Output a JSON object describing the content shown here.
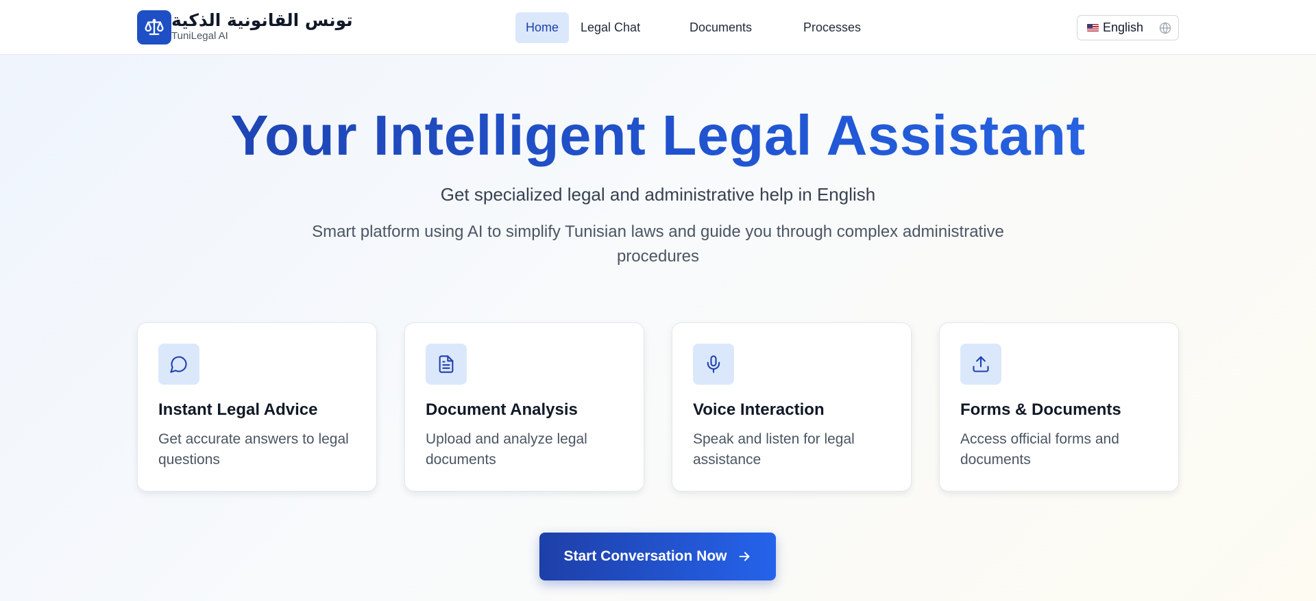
{
  "header": {
    "brand_ar": "تونس القانونية الذكية",
    "brand_en": "TuniLegal AI",
    "nav": [
      {
        "label": "Home",
        "active": true
      },
      {
        "label": "Legal Chat",
        "active": false
      },
      {
        "label": "Documents",
        "active": false
      },
      {
        "label": "Processes",
        "active": false
      }
    ],
    "language": "English"
  },
  "hero": {
    "title": "Your Intelligent Legal Assistant",
    "subtitle": "Get specialized legal and administrative help in English",
    "description": "Smart platform using AI to simplify Tunisian laws and guide you through complex administrative procedures"
  },
  "features": [
    {
      "icon": "chat-bubble-icon",
      "title": "Instant Legal Advice",
      "text": "Get accurate answers to legal questions"
    },
    {
      "icon": "document-icon",
      "title": "Document Analysis",
      "text": "Upload and analyze legal documents"
    },
    {
      "icon": "microphone-icon",
      "title": "Voice Interaction",
      "text": "Speak and listen for legal assistance"
    },
    {
      "icon": "upload-icon",
      "title": "Forms & Documents",
      "text": "Access official forms and documents"
    }
  ],
  "cta": {
    "label": "Start Conversation Now"
  },
  "colors": {
    "primary": "#1e40af",
    "accent": "#2563eb",
    "icon_bg": "#dbe8fb"
  }
}
